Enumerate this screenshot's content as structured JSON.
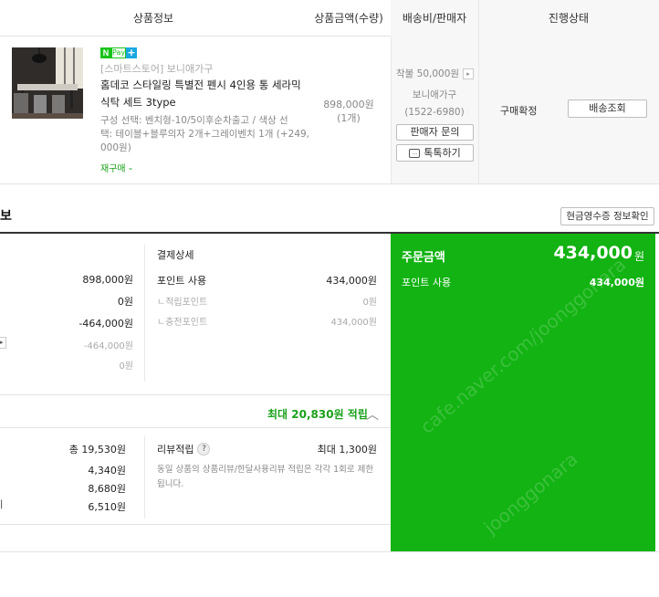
{
  "table_header": {
    "product_info": "상품정보",
    "amount_qty": "상품금액(수량)",
    "shipping_seller": "배송비/판매자",
    "status": "진행상태"
  },
  "product": {
    "npay_label": "Pay",
    "store": "[스마트스토어] 보니애가구",
    "name_line1": "홈데코 스타일링 특별전 펜시 4인용 통 세라믹",
    "name_line2": "식탁 세트 3type",
    "option_line1": "구성 선택: 벤치형-10/5이후순차출고 / 색상 선",
    "option_line2": "택: 테이블+블루의자 2개+그레이벤치 1개 (+249,",
    "option_line3": "000원)",
    "reorder": "재구매",
    "price": "898,000원",
    "qty": "(1개)",
    "shipping": "착불 50,000원",
    "seller": "보니애가구",
    "phone": "(1522-6980)",
    "contact_btn": "판매자 문의",
    "talk_btn": "톡톡하기",
    "status": "구매확정",
    "delivery_btn": "배송조회"
  },
  "section": {
    "title_fragment": "보",
    "receipt_btn": "현금영수증 정보확인"
  },
  "left_amounts": [
    "898,000원",
    "0원",
    "-464,000원",
    "-464,000원",
    "0원"
  ],
  "payment_detail": {
    "title": "결제상세",
    "point_use_label": "포인트 사용",
    "point_use_value": "434,000원",
    "earned_label": "ㄴ적립포인트",
    "earned_value": "0원",
    "charged_label": "ㄴ충전포인트",
    "charged_value": "434,000원"
  },
  "order_total": {
    "label": "주문금액",
    "value": "434,000",
    "unit": "원",
    "point_label": "포인트 사용",
    "point_value": "434,000원"
  },
  "reward": {
    "max_text": "최대 20,830원 적립",
    "total": "총 19,530원",
    "items": [
      "4,340원",
      "8,680원",
      "6,510원"
    ],
    "review_label": "리뷰적립",
    "review_help": "?",
    "review_max": "최대 1,300원",
    "review_note1": "동일 상품의 상품리뷰/한달사용리뷰 적립은 각각 1회로 제한",
    "review_note2": "됩니다."
  },
  "colors": {
    "green": "#12b312",
    "accent_green": "#1ba11b"
  }
}
